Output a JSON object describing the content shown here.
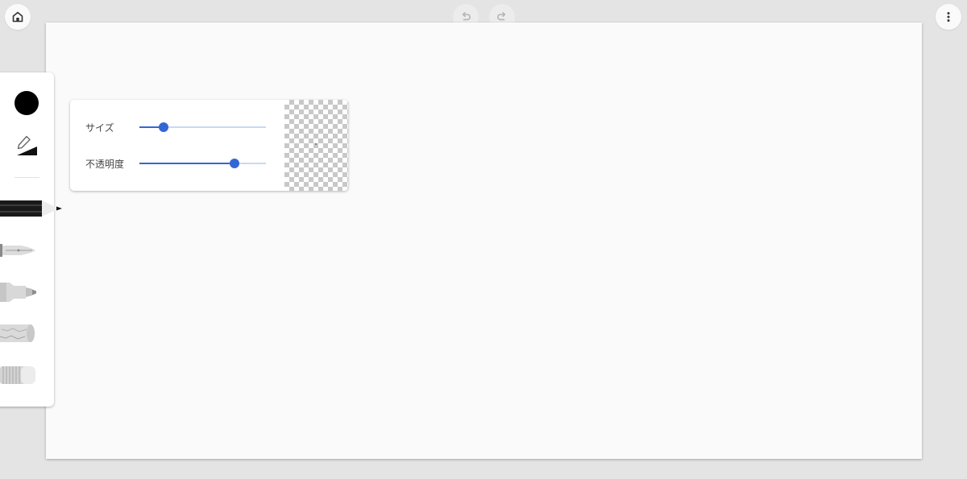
{
  "toolbar": {
    "home_icon": "home-icon",
    "undo_icon": "undo-icon",
    "redo_icon": "redo-icon",
    "menu_icon": "more-vert-icon"
  },
  "tools": {
    "selected_color": "#000000",
    "accent_color": "#3367d6",
    "items": [
      {
        "name": "pencil",
        "icon": "pencil-icon",
        "selected": true
      },
      {
        "name": "fountain-pen",
        "icon": "fountain-pen-icon",
        "selected": false
      },
      {
        "name": "marker",
        "icon": "marker-icon",
        "selected": false
      },
      {
        "name": "chalk",
        "icon": "chalk-icon",
        "selected": false
      },
      {
        "name": "eraser",
        "icon": "eraser-icon",
        "selected": false
      }
    ]
  },
  "brush_settings": {
    "size_label": "サイズ",
    "size_value": 0.19,
    "opacity_label": "不透明度",
    "opacity_value": 0.75
  }
}
